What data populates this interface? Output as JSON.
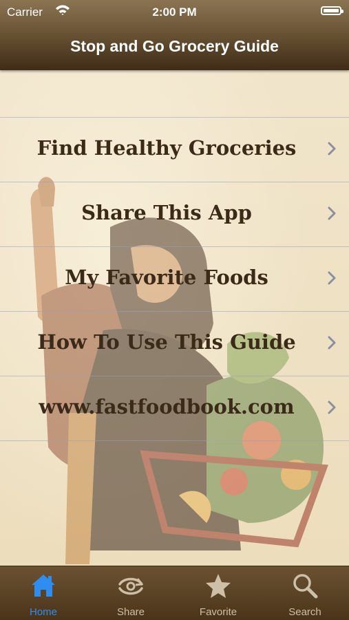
{
  "status_bar": {
    "carrier": "Carrier",
    "time": "2:00 PM"
  },
  "nav": {
    "title": "Stop and Go Grocery Guide"
  },
  "menu": {
    "items": [
      {
        "label": "Find Healthy Groceries"
      },
      {
        "label": "Share This App"
      },
      {
        "label": "My Favorite Foods"
      },
      {
        "label": "How To Use This Guide"
      },
      {
        "label": "www.fastfoodbook.com"
      }
    ]
  },
  "tabbar": {
    "tabs": [
      {
        "label": "Home",
        "icon": "home-icon",
        "active": true
      },
      {
        "label": "Share",
        "icon": "share-icon",
        "active": false
      },
      {
        "label": "Favorite",
        "icon": "star-icon",
        "active": false
      },
      {
        "label": "Search",
        "icon": "search-icon",
        "active": false
      }
    ]
  },
  "colors": {
    "nav_bar": "#4a3419",
    "active_tab": "#2f8cf0",
    "inactive_tab": "#cdbfa8",
    "menu_text": "#3b2a18"
  }
}
